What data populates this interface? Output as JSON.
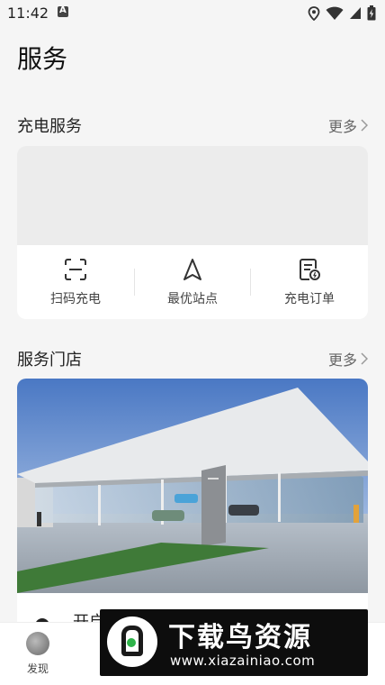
{
  "status_bar": {
    "time": "11:42",
    "icons": [
      "app-notification-icon",
      "location-icon",
      "wifi-icon",
      "signal-icon",
      "battery-icon"
    ]
  },
  "page": {
    "title": "服务"
  },
  "charging": {
    "section_title": "充电服务",
    "more_label": "更多",
    "actions": [
      {
        "label": "扫码充电",
        "icon": "scan-icon"
      },
      {
        "label": "最优站点",
        "icon": "navigation-arrow-icon"
      },
      {
        "label": "充电订单",
        "icon": "order-document-icon"
      }
    ]
  },
  "stores": {
    "section_title": "服务门店",
    "more_label": "更多",
    "store_info_text": "开启"
  },
  "bottom_nav": {
    "items": [
      {
        "label": "发现",
        "icon": "discover-icon"
      }
    ]
  },
  "watermark": {
    "title": "下载鸟资源",
    "url": "www.xiazainiao.com"
  }
}
